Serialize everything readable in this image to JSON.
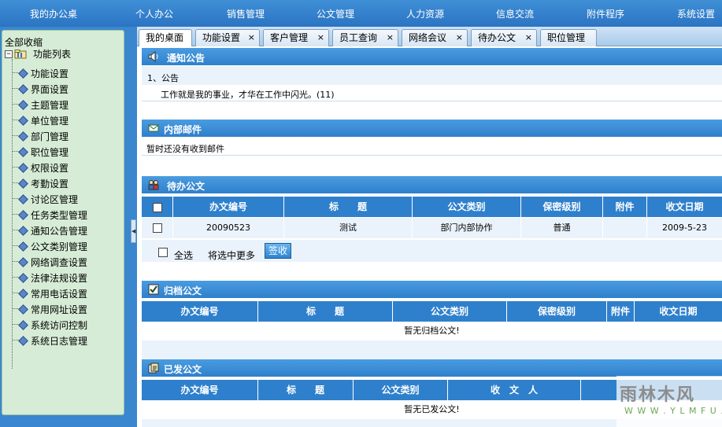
{
  "nav": {
    "items": [
      {
        "label": "我的办公桌"
      },
      {
        "label": "个人办公"
      },
      {
        "label": "销售管理"
      },
      {
        "label": "公文管理"
      },
      {
        "label": "人力资源"
      },
      {
        "label": "信息交流"
      },
      {
        "label": "附件程序"
      },
      {
        "label": "系统设置"
      }
    ]
  },
  "sidebar": {
    "collapse_all": "全部收缩",
    "root_label": "功能列表",
    "items": [
      {
        "label": "功能设置"
      },
      {
        "label": "界面设置"
      },
      {
        "label": "主题管理"
      },
      {
        "label": "单位管理"
      },
      {
        "label": "部门管理"
      },
      {
        "label": "职位管理"
      },
      {
        "label": "权限设置"
      },
      {
        "label": "考勤设置"
      },
      {
        "label": "讨论区管理"
      },
      {
        "label": "任务类型管理"
      },
      {
        "label": "通知公告管理"
      },
      {
        "label": "公文类别管理"
      },
      {
        "label": "网络调查设置"
      },
      {
        "label": "法律法规设置"
      },
      {
        "label": "常用电话设置"
      },
      {
        "label": "常用网址设置"
      },
      {
        "label": "系统访问控制"
      },
      {
        "label": "系统日志管理"
      }
    ]
  },
  "tabs": [
    {
      "label": "我的桌面",
      "closable": false
    },
    {
      "label": "功能设置",
      "closable": true
    },
    {
      "label": "客户管理",
      "closable": true
    },
    {
      "label": "员工查询",
      "closable": true
    },
    {
      "label": "网络会议",
      "closable": true
    },
    {
      "label": "待办公文",
      "closable": true
    },
    {
      "label": "职位管理",
      "closable": false
    }
  ],
  "tab_close_glyph": "×",
  "notice": {
    "title": "通知公告",
    "item_index": "1、公告",
    "item_text": "工作就是我的事业，才华在工作中闪光。(11)"
  },
  "mail": {
    "title": "内部邮件",
    "empty_text": "暂时还没有收到邮件"
  },
  "pending": {
    "title": "待办公文",
    "headers": [
      "办文编号",
      "标　　题",
      "公文类别",
      "保密级别",
      "附件",
      "收文日期"
    ],
    "rows": [
      {
        "number": "20090523",
        "title": "测试",
        "category": "部门内部协作",
        "secrecy": "普通",
        "attachment": "",
        "date": "2009-5-23"
      }
    ],
    "select_all": "全选",
    "more_label": "将选中更多",
    "sign_button": "签收"
  },
  "archived": {
    "title": "归档公文",
    "headers": [
      "办文编号",
      "标　　题",
      "公文类别",
      "保密级别",
      "附件",
      "收文日期"
    ],
    "empty_text": "暂无归档公文!"
  },
  "sent": {
    "title": "已发公文",
    "headers": [
      "办文编号",
      "标　　题",
      "公文类别",
      "收　文　人"
    ],
    "empty_text": "暂无已发公文!"
  },
  "watermark": {
    "main": "雨林木风",
    "sub": "W W W . Y L M F U . C O M"
  },
  "colors": {
    "nav_bg": "#2b74c3",
    "section_header": "#2f80cc",
    "sidebar_bg": "#d6ecd6",
    "row_bg": "#eaf3fb"
  }
}
